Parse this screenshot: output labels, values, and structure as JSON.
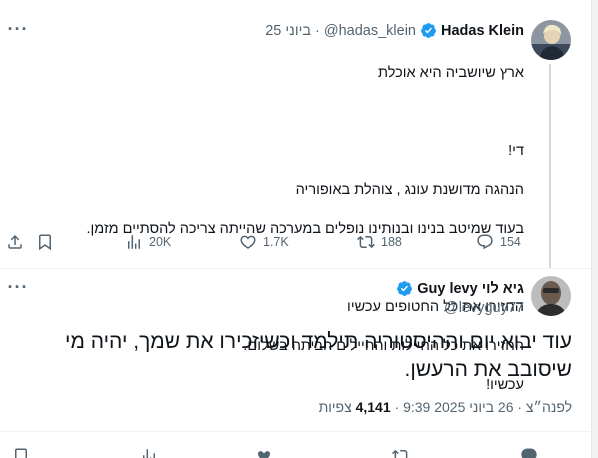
{
  "parent_tweet": {
    "display_name": "Hadas Klein",
    "handle": "@hadas_klein",
    "separator": "·",
    "date": "ביוני 25",
    "lines": [
      "ארץ שיושביה היא אוכלת",
      "",
      "די!",
      "הנהגה מדושנת עונג , צוהלת באופוריה",
      "בעוד שמיטב בנינו ובנותינו נופלים במערכה שהייתה צריכה להסתיים מזמן.",
      "",
      "החזירו את כל החטופים עכשיו",
      "החזירו את כל החיילות והחיילים הביתה בשלום.",
      "עכשיו!"
    ],
    "metrics": {
      "replies": "154",
      "reposts": "188",
      "likes": "1.7K",
      "views": "20K"
    },
    "more_label": "···"
  },
  "main_tweet": {
    "display_name": "Guy levy גיא לוי",
    "handle": "@levyguy77",
    "text": "עוד יבוא יום וההיסטוריה תילמד וכשיזכירו את שמך, יהיה מי שיסובב את הרעשן.",
    "timestamp": "לפנה״צ · 26 ביוני 2025 9:39",
    "views_count": "4,141",
    "views_label": "צפיות",
    "more_label": "···"
  },
  "colors": {
    "verified": "#1d9bf0",
    "text": "#0f1419",
    "muted": "#536471"
  },
  "icons": [
    "verified-badge-icon",
    "reply-icon",
    "repost-icon",
    "like-icon",
    "views-icon",
    "bookmark-icon",
    "share-icon",
    "more-icon"
  ]
}
